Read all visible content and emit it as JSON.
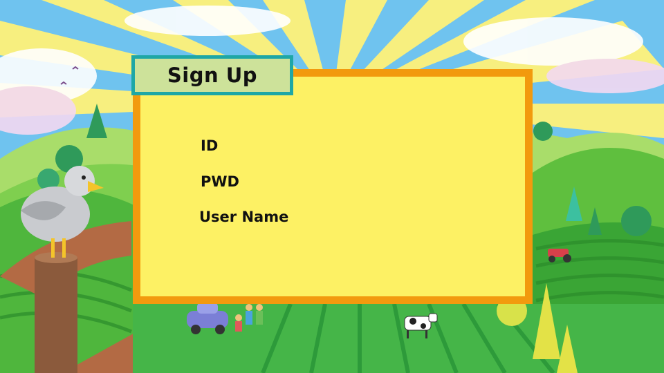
{
  "dialog": {
    "title": "Sign Up",
    "fields": [
      {
        "label": "ID",
        "value": ""
      },
      {
        "label": "PWD",
        "value": ""
      },
      {
        "label": "User Name",
        "value": ""
      }
    ]
  },
  "colors": {
    "panel_fill": "#fdf164",
    "panel_border": "#f29a0e",
    "tab_fill": "#cde29a",
    "tab_border": "#1ea7a6",
    "sky": "#6fc3ef",
    "sun_rays": "#fff27a"
  },
  "scene": {
    "characters": [
      "seagull",
      "car",
      "children",
      "cow",
      "tractor"
    ]
  }
}
